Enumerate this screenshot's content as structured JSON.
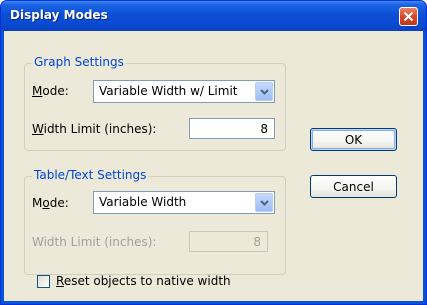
{
  "window": {
    "title": "Display Modes"
  },
  "graph_settings": {
    "legend": "Graph Settings",
    "mode_label": "Mode:",
    "mode_value": "Variable Width w/ Limit",
    "width_limit_label": "Width Limit (inches):",
    "width_limit_value": "8"
  },
  "table_settings": {
    "legend": "Table/Text Settings",
    "mode_label": "Mode:",
    "mode_value": "Variable Width",
    "width_limit_label": "Width Limit (inches):",
    "width_limit_value": "8"
  },
  "buttons": {
    "ok": "OK",
    "cancel": "Cancel"
  },
  "reset_checkbox": {
    "label": "Reset objects to native width",
    "checked": false
  },
  "colors": {
    "titlebar": "#0a4fd6",
    "groupbox_legend": "#0046d5",
    "dialog_background": "#ece9d8",
    "close_button": "#d9462a"
  }
}
